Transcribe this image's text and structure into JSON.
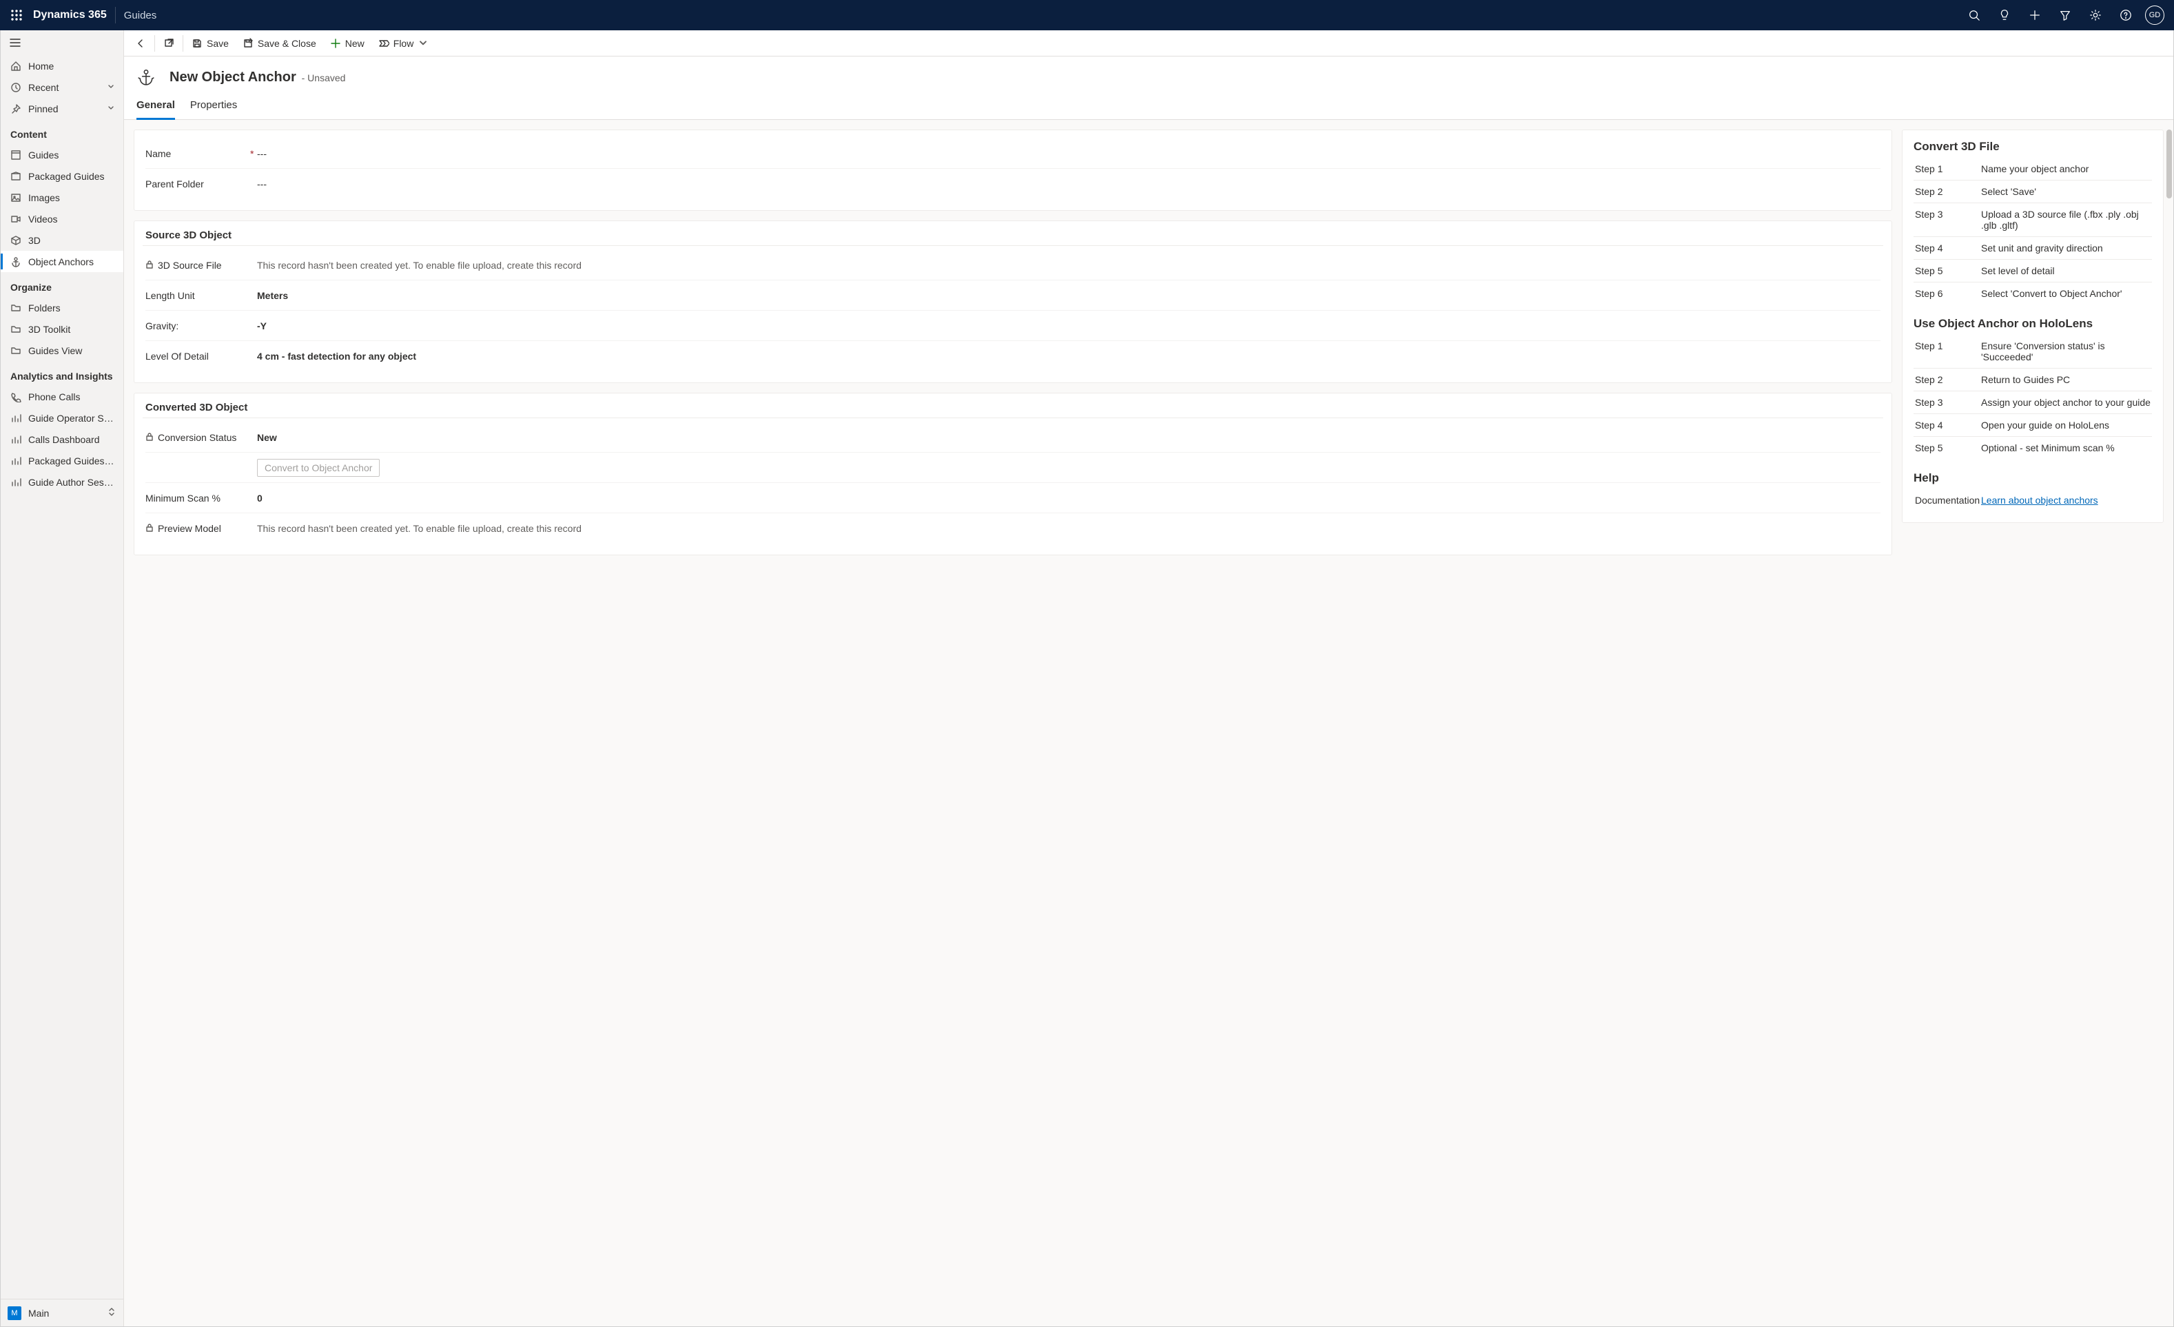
{
  "header": {
    "brand": "Dynamics 365",
    "app": "Guides",
    "avatar": "GD"
  },
  "nav": {
    "home": "Home",
    "recent": "Recent",
    "pinned": "Pinned",
    "group_content": "Content",
    "guides": "Guides",
    "packaged_guides": "Packaged Guides",
    "images": "Images",
    "videos": "Videos",
    "three_d": "3D",
    "object_anchors": "Object Anchors",
    "group_organize": "Organize",
    "folders": "Folders",
    "toolkit": "3D Toolkit",
    "guides_view": "Guides View",
    "group_analytics": "Analytics and Insights",
    "phone_calls": "Phone Calls",
    "op_sessions": "Guide Operator Sessi...",
    "calls_dashboard": "Calls Dashboard",
    "packaged_op": "Packaged Guides Op...",
    "author_sessions": "Guide Author Sessions",
    "area_badge": "M",
    "area_name": "Main"
  },
  "cmd": {
    "save": "Save",
    "save_close": "Save & Close",
    "new": "New",
    "flow": "Flow"
  },
  "record": {
    "title": "New Object Anchor",
    "status": "- Unsaved"
  },
  "tabs": {
    "general": "General",
    "properties": "Properties"
  },
  "form": {
    "name_label": "Name",
    "name_value": "---",
    "parent_label": "Parent Folder",
    "parent_value": "---",
    "source_section": "Source 3D Object",
    "source_file_label": "3D Source File",
    "source_file_value": "This record hasn't been created yet. To enable file upload, create this record",
    "length_label": "Length Unit",
    "length_value": "Meters",
    "gravity_label": "Gravity:",
    "gravity_value": "-Y",
    "lod_label": "Level Of Detail",
    "lod_value": "4 cm - fast detection for any object",
    "converted_section": "Converted 3D Object",
    "conv_status_label": "Conversion Status",
    "conv_status_value": "New",
    "convert_btn": "Convert to Object Anchor",
    "min_scan_label": "Minimum Scan %",
    "min_scan_value": "0",
    "preview_label": "Preview Model",
    "preview_value": "This record hasn't been created yet. To enable file upload, create this record"
  },
  "side": {
    "convert_h": "Convert 3D File",
    "c_steps": [
      {
        "k": "Step 1",
        "v": "Name your object anchor"
      },
      {
        "k": "Step 2",
        "v": "Select 'Save'"
      },
      {
        "k": "Step 3",
        "v": "Upload a 3D source file (.fbx .ply .obj .glb .gltf)"
      },
      {
        "k": "Step 4",
        "v": "Set unit and gravity direction"
      },
      {
        "k": "Step 5",
        "v": "Set level of detail"
      },
      {
        "k": "Step 6",
        "v": "Select 'Convert to Object Anchor'"
      }
    ],
    "use_h": "Use Object Anchor on HoloLens",
    "u_steps": [
      {
        "k": "Step 1",
        "v": "Ensure 'Conversion status' is 'Succeeded'"
      },
      {
        "k": "Step 2",
        "v": "Return to Guides PC"
      },
      {
        "k": "Step 3",
        "v": "Assign your object anchor to your guide"
      },
      {
        "k": "Step 4",
        "v": "Open your guide on HoloLens"
      },
      {
        "k": "Step 5",
        "v": "Optional - set Minimum scan %"
      }
    ],
    "help_h": "Help",
    "doc_label": "Documentation",
    "doc_link": "Learn about object anchors"
  }
}
